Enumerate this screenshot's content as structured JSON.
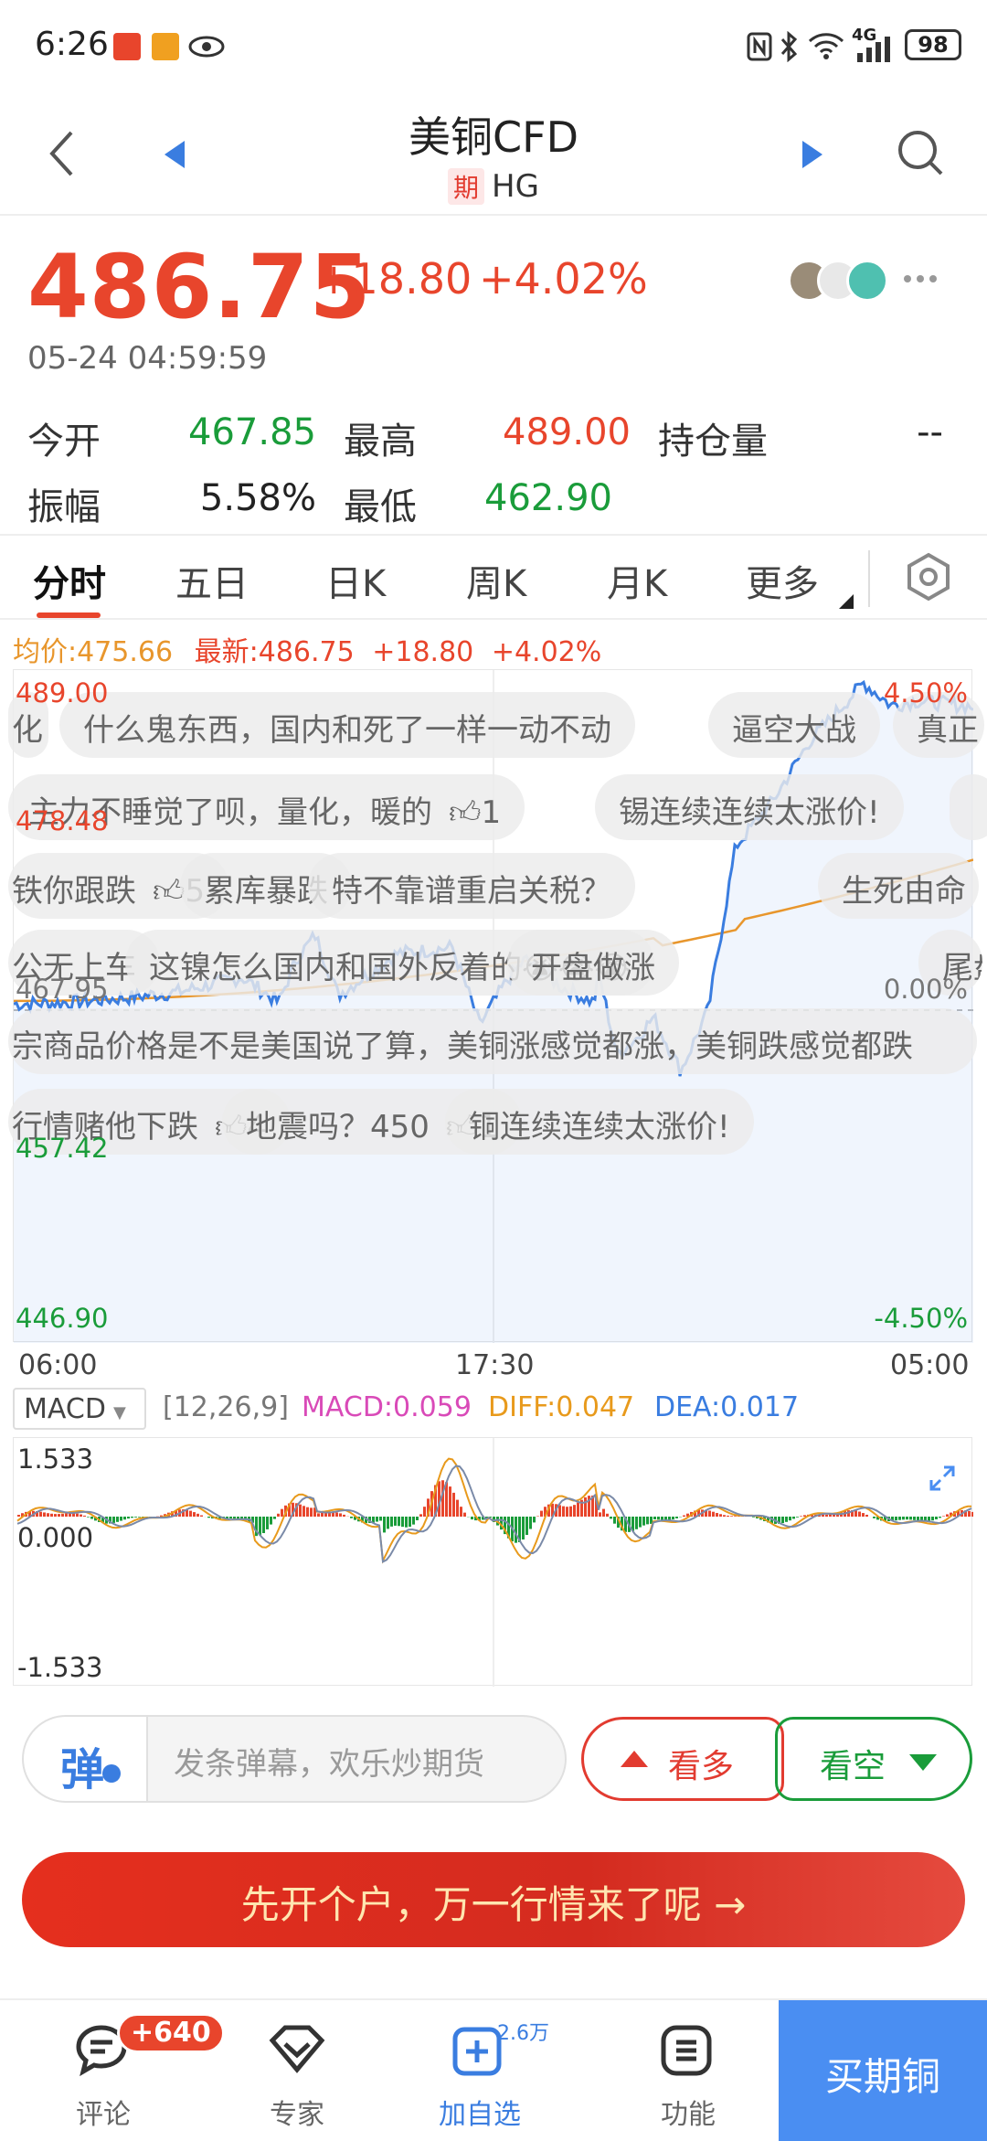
{
  "status_bar": {
    "time": "6:26",
    "battery": "98",
    "signal": "4G"
  },
  "header": {
    "title": "美铜CFD",
    "tag": "期",
    "code": "HG"
  },
  "quote": {
    "price": "486.75",
    "change": "+18.80",
    "change_pct": "+4.02%",
    "timestamp": "05-24 04:59:59",
    "open_label": "今开",
    "open": "467.85",
    "high_label": "最高",
    "high": "489.00",
    "oi_label": "持仓量",
    "oi": "--",
    "amp_label": "振幅",
    "amp": "5.58%",
    "low_label": "最低",
    "low": "462.90"
  },
  "tabs": [
    "分时",
    "五日",
    "日K",
    "周K",
    "月K",
    "更多"
  ],
  "legend": {
    "avg": "均价:475.66",
    "latest": "最新:486.75",
    "chg": "+18.80",
    "pct": "+4.02%"
  },
  "chart": {
    "y_labels": [
      "489.00",
      "478.48",
      "467.95",
      "457.42",
      "446.90"
    ],
    "pct_labels": [
      "4.50%",
      "0.00%",
      "-4.50%"
    ],
    "x_labels": [
      "06:00",
      "17:30",
      "05:00"
    ]
  },
  "macd": {
    "selector": "MACD",
    "params": "[12,26,9]",
    "macd": "MACD:0.059",
    "diff": "DIFF:0.047",
    "dea": "DEA:0.017",
    "y_labels": [
      "1.533",
      "0.000",
      "-1.533"
    ]
  },
  "danmu": [
    {
      "text": "化"
    },
    {
      "text": "什么鬼东西，国内和死了一样一动不动"
    },
    {
      "text": "逼空大战"
    },
    {
      "text": "真正"
    },
    {
      "text": "主力不睡觉了呗，量化，暖的",
      "likes": "1"
    },
    {
      "text": "锡连续连续太涨价!"
    },
    {
      "text": "铁你跟跌",
      "likes": "5"
    },
    {
      "text": "累库暴跌"
    },
    {
      "text": "特不靠谱重启关税？"
    },
    {
      "text": "生死由命"
    },
    {
      "text": "公无上车"
    },
    {
      "text": "这镍怎么国内和国外反着的😭😭😭"
    },
    {
      "text": "开盘做涨"
    },
    {
      "text": "尾盘"
    },
    {
      "text": "宗商品价格是不是美国说了算，美铜涨感觉都涨，美铜跌感觉都跌"
    },
    {
      "text": "行情赌他下跌",
      "likes": "4"
    },
    {
      "text": "地震吗？450",
      "likes": "1"
    },
    {
      "text": "铜连续连续太涨价!"
    }
  ],
  "input": {
    "btn": "弹",
    "placeholder": "发条弹幕，欢乐炒期货",
    "bull": "看多",
    "bear": "看空"
  },
  "cta": {
    "text": "先开个户，万一行情来了呢 →"
  },
  "bottom_nav": {
    "comment": "评论",
    "badge": "+640",
    "expert": "专家",
    "add": "加自选",
    "add_count": "2.6万",
    "func": "功能",
    "buy": "买期铜"
  },
  "colors": {
    "up": "#e8452c",
    "down": "#1a9c3a",
    "line": "#3a7de0",
    "avg": "#e8962c",
    "buy": "#4a8ef2"
  }
}
